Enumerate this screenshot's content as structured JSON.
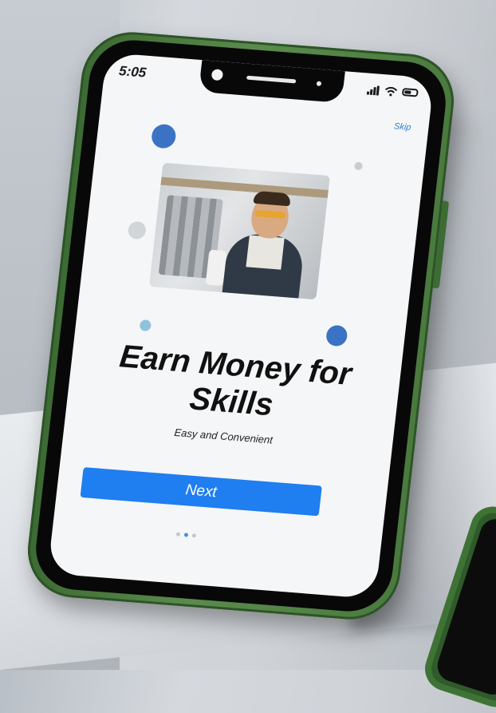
{
  "status_bar": {
    "time": "5:05",
    "signal_icon": "signal-icon",
    "wifi_icon": "wifi-icon",
    "battery_icon": "battery-icon"
  },
  "onboarding": {
    "skip_label": "Skip",
    "title": "Earn Money for Skills",
    "subtitle": "Easy and Convenient",
    "next_label": "Next",
    "page_indicator": {
      "total": 3,
      "active_index": 1
    }
  },
  "colors": {
    "accent": "#1f7ef0",
    "decor_blue": "#3b73c4",
    "decor_light_blue": "#8fc3dc",
    "phone_frame": "#4a7a3e"
  }
}
